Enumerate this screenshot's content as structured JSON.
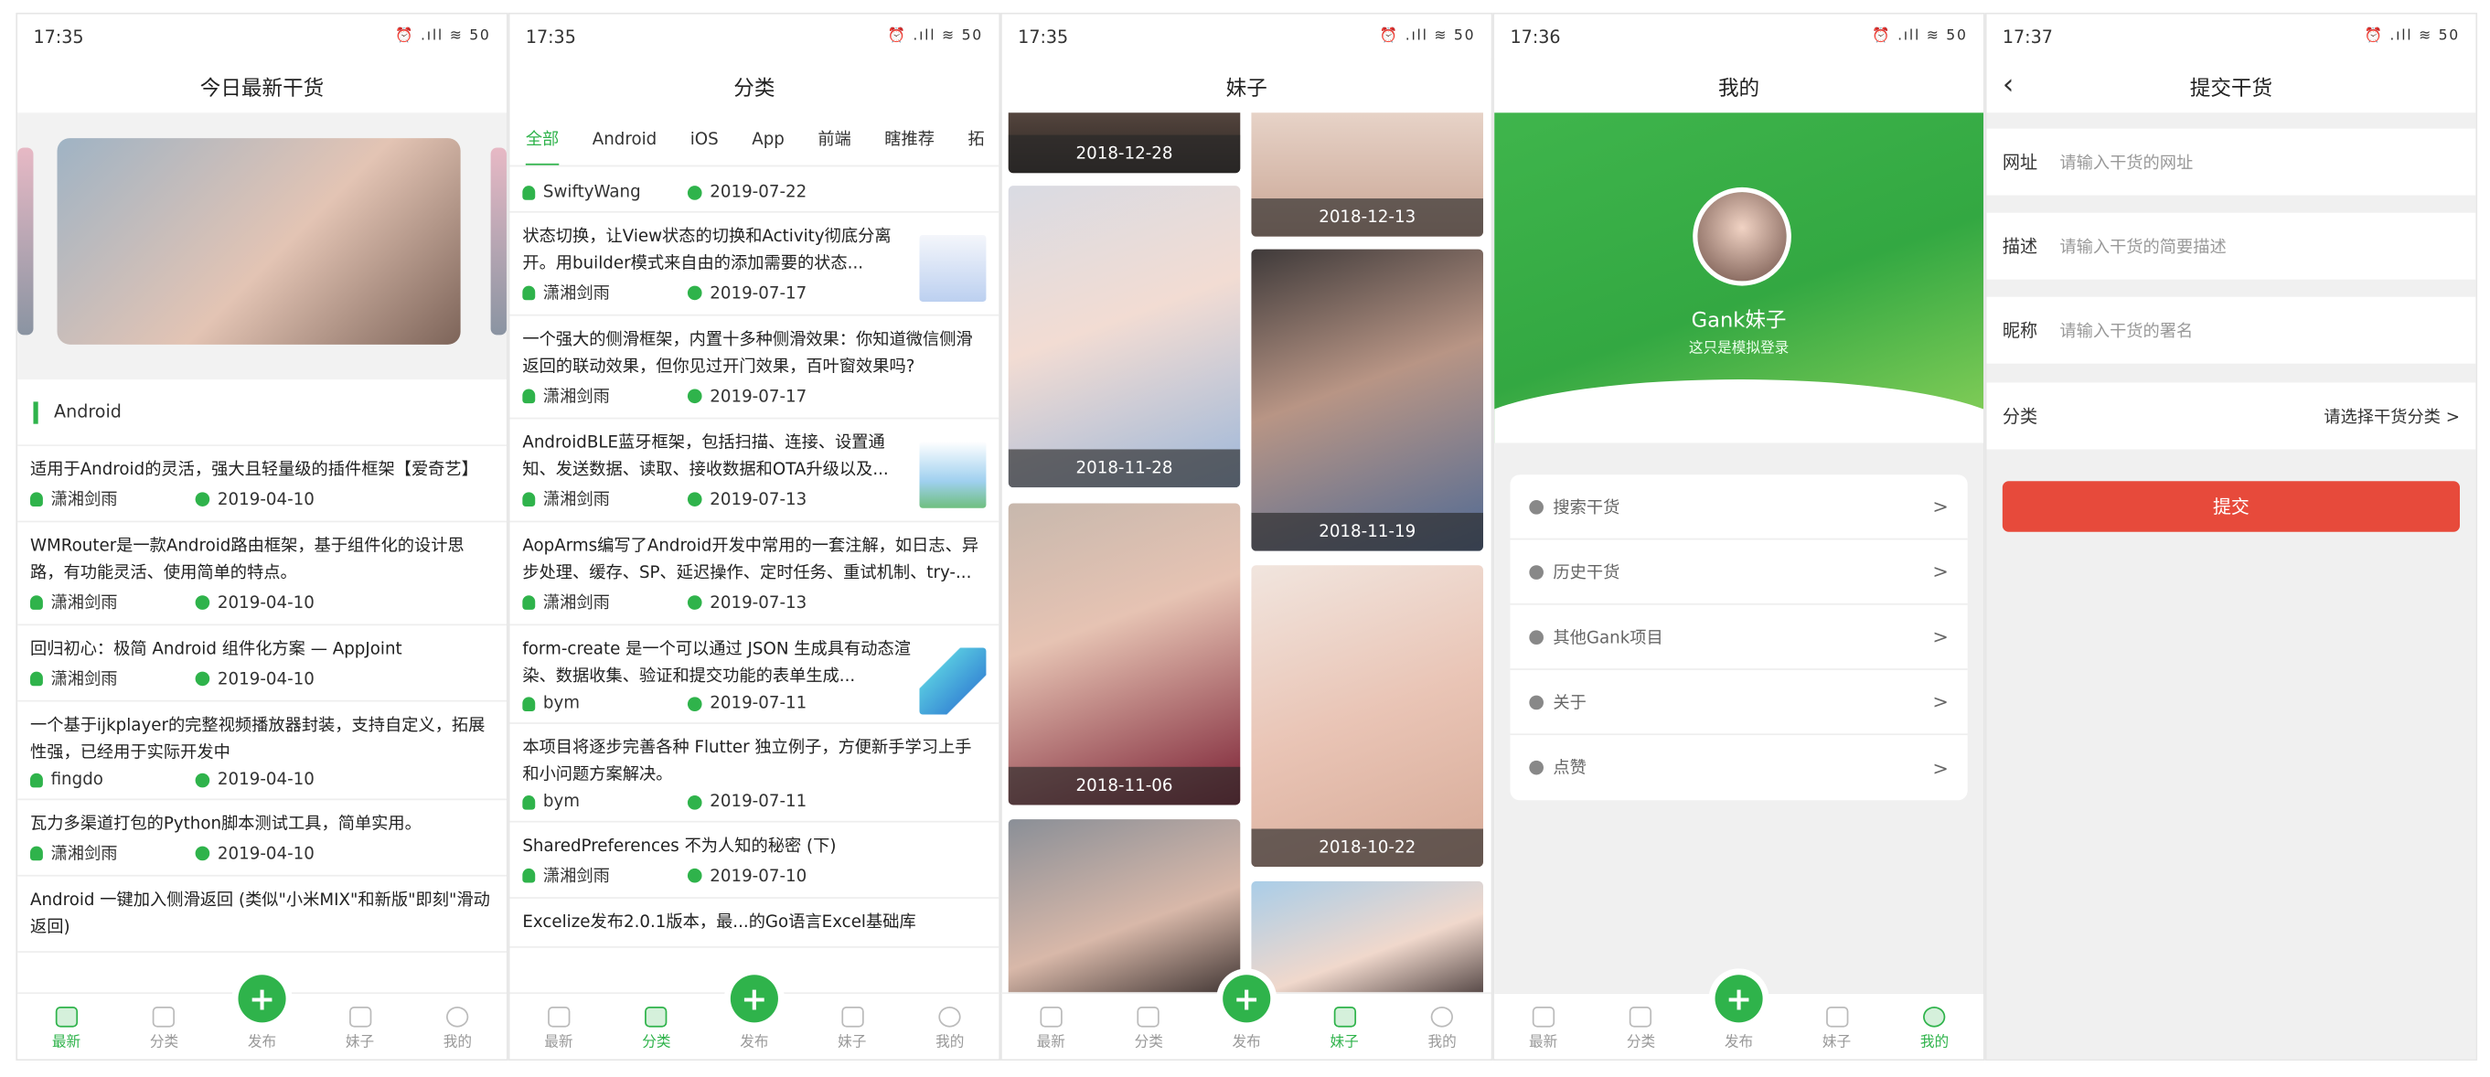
{
  "screens": [
    {
      "time": "17:35",
      "title": "今日最新干货"
    },
    {
      "time": "17:35",
      "title": "分类"
    },
    {
      "time": "17:35",
      "title": "妹子"
    },
    {
      "time": "17:36",
      "title": "我的"
    },
    {
      "time": "17:37",
      "title": "提交干货"
    }
  ],
  "status_icons": "⏰ .ıll ≋ 50",
  "tabs": {
    "latest": "最新",
    "category": "分类",
    "publish": "发布",
    "girl": "妹子",
    "mine": "我的",
    "plus": "+"
  },
  "home": {
    "section": "Android",
    "items": [
      {
        "title": "适用于Android的灵活，强大且轻量级的插件框架【爱奇艺】",
        "author": "潇湘剑雨",
        "date": "2019-04-10"
      },
      {
        "title": "WMRouter是一款Android路由框架，基于组件化的设计思路，有功能灵活、使用简单的特点。",
        "author": "潇湘剑雨",
        "date": "2019-04-10"
      },
      {
        "title": "回归初心：极简 Android 组件化方案 — AppJoint",
        "author": "潇湘剑雨",
        "date": "2019-04-10"
      },
      {
        "title": "一个基于ijkplayer的完整视频播放器封装，支持自定义，拓展性强，已经用于实际开发中",
        "author": "fingdo",
        "date": "2019-04-10"
      },
      {
        "title": "瓦力多渠道打包的Python脚本测试工具，简单实用。",
        "author": "潇湘剑雨",
        "date": "2019-04-10"
      },
      {
        "title": "Android 一键加入侧滑返回 (类似\"小米MIX\"和新版\"即刻\"滑动返回)"
      }
    ]
  },
  "category": {
    "tabs": [
      "全部",
      "Android",
      "iOS",
      "App",
      "前端",
      "瞎推荐",
      "拓"
    ],
    "items": [
      {
        "author": "SwiftyWang",
        "date": "2019-07-22"
      },
      {
        "title": "状态切换，让View状态的切换和Activity彻底分离开。用builder模式来自由的添加需要的状态...",
        "author": "潇湘剑雨",
        "date": "2019-07-17"
      },
      {
        "title": "一个强大的侧滑框架，内置十多种侧滑效果：你知道微信侧滑返回的联动效果，但你见过开门效果，百叶窗效果吗?",
        "author": "潇湘剑雨",
        "date": "2019-07-17"
      },
      {
        "title": "AndroidBLE蓝牙框架，包括扫描、连接、设置通知、发送数据、读取、接收数据和OTA升级以及...",
        "author": "潇湘剑雨",
        "date": "2019-07-13"
      },
      {
        "title": "AopArms编写了Android开发中常用的一套注解，如日志、异步处理、缓存、SP、延迟操作、定时任务、重试机制、try-...",
        "author": "潇湘剑雨",
        "date": "2019-07-13"
      },
      {
        "title": "form-create 是一个可以通过 JSON 生成具有动态渲染、数据收集、验证和提交功能的表单生成...",
        "author": "bym",
        "date": "2019-07-11"
      },
      {
        "title": "本项目将逐步完善各种 Flutter 独立例子，方便新手学习上手和小问题方案解决。",
        "author": "bym",
        "date": "2019-07-11"
      },
      {
        "title": "SharedPreferences 不为人知的秘密 (下)",
        "author": "潇湘剑雨",
        "date": "2019-07-10"
      },
      {
        "title": "Excelize发布2.0.1版本，最...的Go语言Excel基础库"
      }
    ]
  },
  "girls": {
    "dates": [
      "2018-12-28",
      "2018-12-13",
      "2018-11-28",
      "2018-11-19",
      "2018-11-06",
      "2018-10-22"
    ]
  },
  "mine": {
    "name": "Gank妹子",
    "subtitle": "这只是模拟登录",
    "menu": [
      "搜索干货",
      "历史干货",
      "其他Gank项目",
      "关于",
      "点赞"
    ]
  },
  "submit": {
    "fields": [
      {
        "label": "网址",
        "placeholder": "请输入干货的网址"
      },
      {
        "label": "描述",
        "placeholder": "请输入干货的简要描述"
      },
      {
        "label": "昵称",
        "placeholder": "请输入干货的署名"
      }
    ],
    "category_label": "分类",
    "category_value": "请选择干货分类 >",
    "button": "提交"
  },
  "colors": {
    "accent": "#2fb34b",
    "submit": "#e74a3b"
  }
}
